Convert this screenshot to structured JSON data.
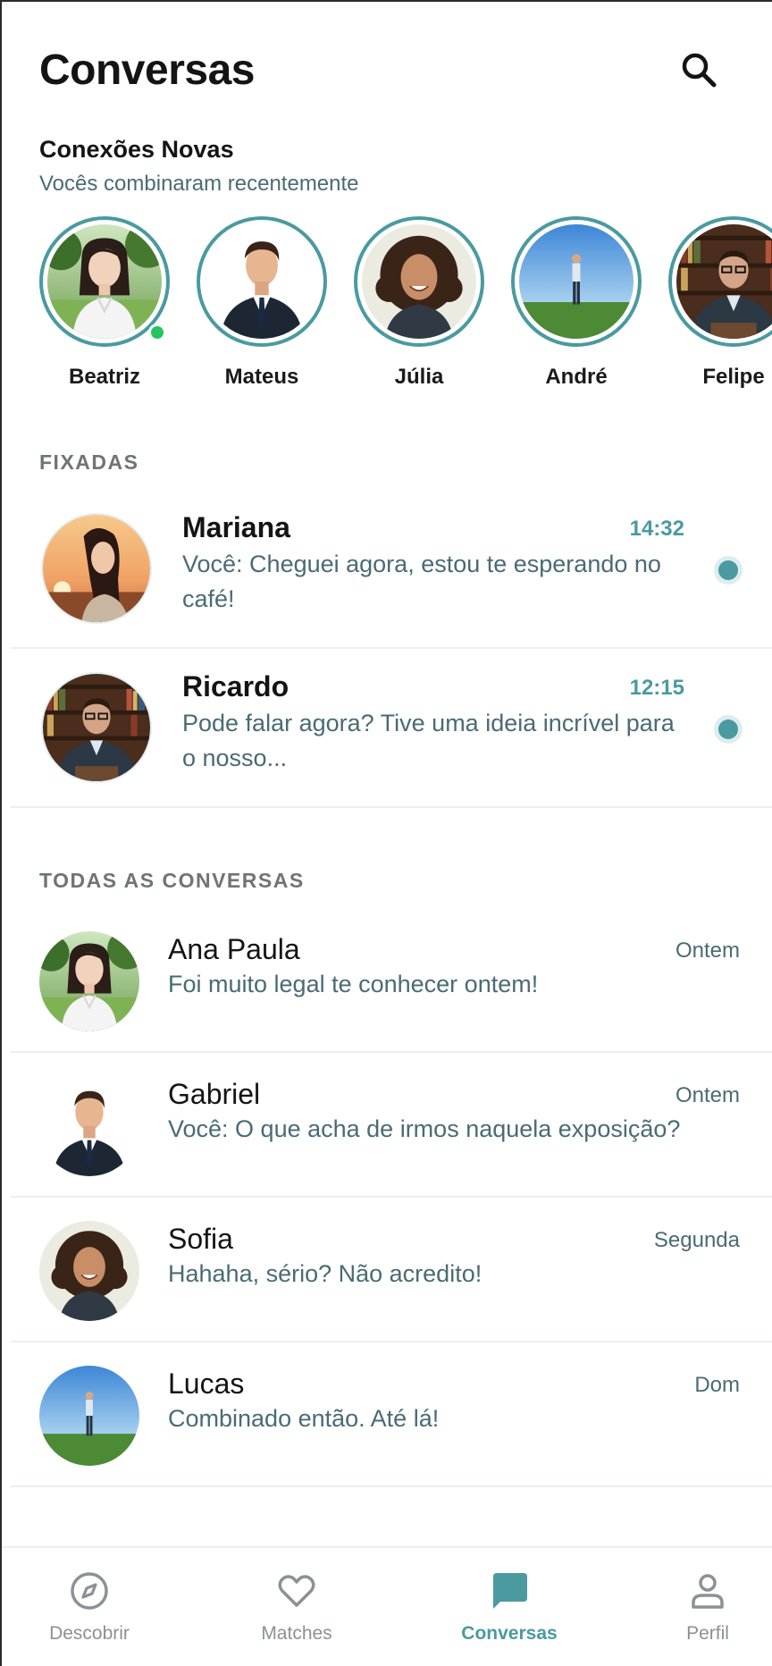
{
  "header": {
    "title": "Conversas",
    "search_icon": "search-icon"
  },
  "new_connections": {
    "title": "Conexões Novas",
    "subtitle": "Vocês combinaram recentemente",
    "items": [
      {
        "name": "Beatriz",
        "avatar": "woman-park",
        "online": true
      },
      {
        "name": "Mateus",
        "avatar": "man-suit",
        "online": false
      },
      {
        "name": "Júlia",
        "avatar": "woman-curly",
        "online": false
      },
      {
        "name": "André",
        "avatar": "man-field",
        "online": false
      },
      {
        "name": "Felipe",
        "avatar": "man-library",
        "online": false
      }
    ]
  },
  "pinned": {
    "label": "FIXADAS",
    "items": [
      {
        "name": "Mariana",
        "time": "14:32",
        "message": "Você: Cheguei agora, estou te esperando no café!",
        "unread": true,
        "avatar": "woman-sunset"
      },
      {
        "name": "Ricardo",
        "time": "12:15",
        "message": "Pode falar agora? Tive uma ideia incrível para o nosso...",
        "unread": true,
        "avatar": "man-library"
      }
    ]
  },
  "all_chats": {
    "label": "TODAS AS CONVERSAS",
    "items": [
      {
        "name": "Ana Paula",
        "time": "Ontem",
        "message": "Foi muito legal te conhecer ontem!",
        "avatar": "woman-park"
      },
      {
        "name": "Gabriel",
        "time": "Ontem",
        "message": "Você: O que acha de irmos naquela exposição?",
        "avatar": "man-suit"
      },
      {
        "name": "Sofia",
        "time": "Segunda",
        "message": "Hahaha, sério? Não acredito!",
        "avatar": "woman-curly"
      },
      {
        "name": "Lucas",
        "time": "Dom",
        "message": "Combinado então. Até lá!",
        "avatar": "man-field"
      }
    ]
  },
  "nav": {
    "items": [
      {
        "label": "Descobrir",
        "icon": "compass-icon",
        "active": false
      },
      {
        "label": "Matches",
        "icon": "heart-icon",
        "active": false
      },
      {
        "label": "Conversas",
        "icon": "chat-icon",
        "active": true
      },
      {
        "label": "Perfil",
        "icon": "user-icon",
        "active": false
      }
    ]
  },
  "colors": {
    "accent": "#4a9aa0",
    "secondary_text": "#4a6b74",
    "online": "#22c55e",
    "inactive_nav": "#8a9296"
  }
}
